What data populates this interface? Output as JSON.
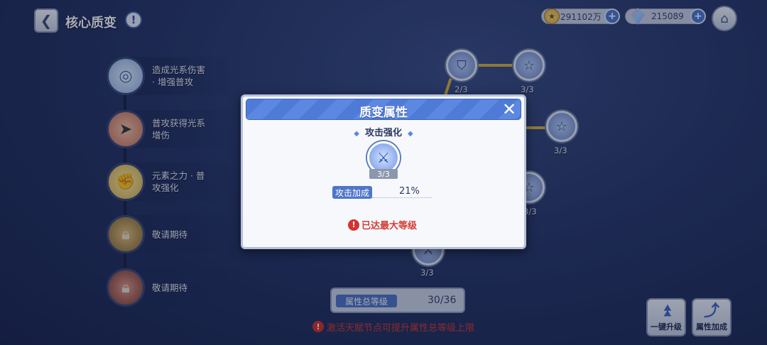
{
  "header": {
    "back_icon": "chevron-left-icon",
    "title": "核心质变",
    "info_icon": "exclamation-icon",
    "gold": "291102万",
    "gems": "215089",
    "home_icon": "home-icon"
  },
  "left_list": [
    {
      "label": "造成光系伤害\n· 增强普攻",
      "icon": "swirl-icon"
    },
    {
      "label": "普攻获得光系\n增伤",
      "icon": "bullet-icon"
    },
    {
      "label": "元素之力 · 普\n攻强化",
      "icon": "strength-icon"
    },
    {
      "label": "敬请期待",
      "icon": "lock-icon"
    },
    {
      "label": "敬请期待",
      "icon": "lock-icon"
    }
  ],
  "tree_nodes": [
    {
      "count": "2/3",
      "icon": "shield-icon"
    },
    {
      "count": "3/3",
      "icon": "star-icon"
    },
    {
      "count": "3/3",
      "icon": "star-icon"
    },
    {
      "count": "3/3",
      "icon": "star-icon"
    },
    {
      "count": "3/3",
      "icon": "sword-icon"
    }
  ],
  "total": {
    "label": "属性总等级",
    "value": "30/36"
  },
  "bottom_warning": "激活天赋节点可提升属性总等级上限",
  "buttons": {
    "upgrade_all": "一键升级",
    "attr_bonus": "属性加成"
  },
  "modal": {
    "title": "质变属性",
    "subtitle": "攻击强化",
    "node_icon": "sword-icon",
    "node_count": "3/3",
    "stat_label": "攻击加成",
    "stat_value": "21%",
    "max_text": "已达最大等级"
  },
  "colors": {
    "accent_blue": "#4e75c9",
    "warning_red": "#d53b33",
    "link_gold": "#d8b343"
  }
}
